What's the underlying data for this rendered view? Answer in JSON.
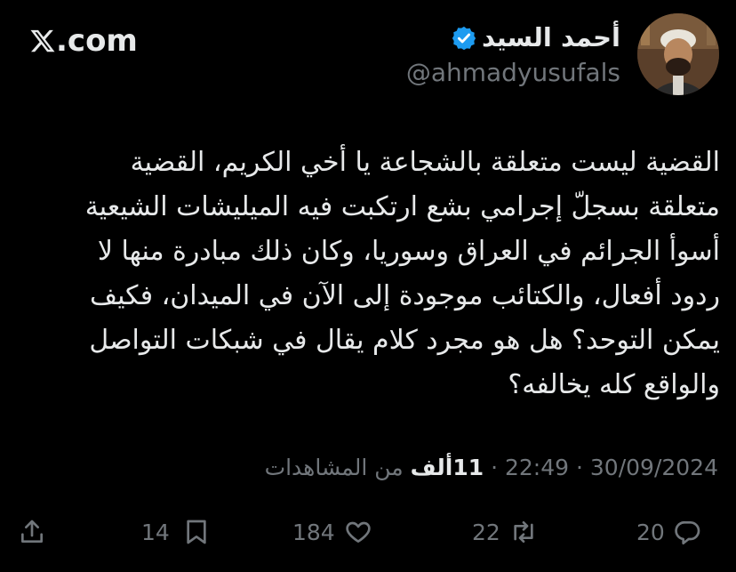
{
  "site": {
    "logo_text": ".com"
  },
  "author": {
    "name": "أحمد السيد",
    "handle": "@ahmadyusufals",
    "verified": true,
    "verified_color": "#1d9bf0"
  },
  "tweet": {
    "lines": [
      "القضية ليست متعلقة بالشجاعة يا أخي الكريم، القضية",
      "متعلقة بسجلّ إجرامي بشع ارتكبت فيه الميليشات الشيعية",
      "أسوأ الجرائم في العراق وسوريا، وكان ذلك مبادرة منها لا",
      "ردود أفعال، والكتائب موجودة إلى الآن في الميدان، فكيف",
      "يمكن التوحد؟ هل هو مجرد كلام يقال في شبكات التواصل",
      "والواقع كله يخالفه؟"
    ]
  },
  "meta": {
    "date": "30/09/2024",
    "time": "22:49",
    "separator": "·",
    "views_count": "11ألف",
    "views_label": "من المشاهدات"
  },
  "actions": {
    "replies": "20",
    "reposts": "22",
    "likes": "184",
    "bookmarks": "14"
  }
}
